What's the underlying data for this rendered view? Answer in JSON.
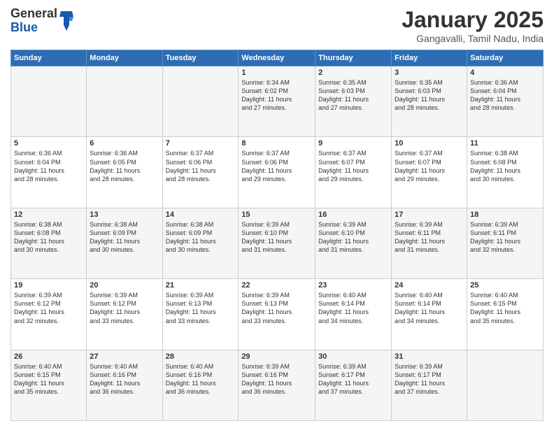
{
  "header": {
    "logo_general": "General",
    "logo_blue": "Blue",
    "title": "January 2025",
    "location": "Gangavalli, Tamil Nadu, India"
  },
  "days_of_week": [
    "Sunday",
    "Monday",
    "Tuesday",
    "Wednesday",
    "Thursday",
    "Friday",
    "Saturday"
  ],
  "weeks": [
    [
      {
        "day": "",
        "info": ""
      },
      {
        "day": "",
        "info": ""
      },
      {
        "day": "",
        "info": ""
      },
      {
        "day": "1",
        "info": "Sunrise: 6:34 AM\nSunset: 6:02 PM\nDaylight: 11 hours\nand 27 minutes."
      },
      {
        "day": "2",
        "info": "Sunrise: 6:35 AM\nSunset: 6:03 PM\nDaylight: 11 hours\nand 27 minutes."
      },
      {
        "day": "3",
        "info": "Sunrise: 6:35 AM\nSunset: 6:03 PM\nDaylight: 11 hours\nand 28 minutes."
      },
      {
        "day": "4",
        "info": "Sunrise: 6:36 AM\nSunset: 6:04 PM\nDaylight: 11 hours\nand 28 minutes."
      }
    ],
    [
      {
        "day": "5",
        "info": "Sunrise: 6:36 AM\nSunset: 6:04 PM\nDaylight: 11 hours\nand 28 minutes."
      },
      {
        "day": "6",
        "info": "Sunrise: 6:36 AM\nSunset: 6:05 PM\nDaylight: 11 hours\nand 28 minutes."
      },
      {
        "day": "7",
        "info": "Sunrise: 6:37 AM\nSunset: 6:06 PM\nDaylight: 11 hours\nand 28 minutes."
      },
      {
        "day": "8",
        "info": "Sunrise: 6:37 AM\nSunset: 6:06 PM\nDaylight: 11 hours\nand 29 minutes."
      },
      {
        "day": "9",
        "info": "Sunrise: 6:37 AM\nSunset: 6:07 PM\nDaylight: 11 hours\nand 29 minutes."
      },
      {
        "day": "10",
        "info": "Sunrise: 6:37 AM\nSunset: 6:07 PM\nDaylight: 11 hours\nand 29 minutes."
      },
      {
        "day": "11",
        "info": "Sunrise: 6:38 AM\nSunset: 6:08 PM\nDaylight: 11 hours\nand 30 minutes."
      }
    ],
    [
      {
        "day": "12",
        "info": "Sunrise: 6:38 AM\nSunset: 6:08 PM\nDaylight: 11 hours\nand 30 minutes."
      },
      {
        "day": "13",
        "info": "Sunrise: 6:38 AM\nSunset: 6:09 PM\nDaylight: 11 hours\nand 30 minutes."
      },
      {
        "day": "14",
        "info": "Sunrise: 6:38 AM\nSunset: 6:09 PM\nDaylight: 11 hours\nand 30 minutes."
      },
      {
        "day": "15",
        "info": "Sunrise: 6:39 AM\nSunset: 6:10 PM\nDaylight: 11 hours\nand 31 minutes."
      },
      {
        "day": "16",
        "info": "Sunrise: 6:39 AM\nSunset: 6:10 PM\nDaylight: 11 hours\nand 31 minutes."
      },
      {
        "day": "17",
        "info": "Sunrise: 6:39 AM\nSunset: 6:11 PM\nDaylight: 11 hours\nand 31 minutes."
      },
      {
        "day": "18",
        "info": "Sunrise: 6:39 AM\nSunset: 6:11 PM\nDaylight: 11 hours\nand 32 minutes."
      }
    ],
    [
      {
        "day": "19",
        "info": "Sunrise: 6:39 AM\nSunset: 6:12 PM\nDaylight: 11 hours\nand 32 minutes."
      },
      {
        "day": "20",
        "info": "Sunrise: 6:39 AM\nSunset: 6:12 PM\nDaylight: 11 hours\nand 33 minutes."
      },
      {
        "day": "21",
        "info": "Sunrise: 6:39 AM\nSunset: 6:13 PM\nDaylight: 11 hours\nand 33 minutes."
      },
      {
        "day": "22",
        "info": "Sunrise: 6:39 AM\nSunset: 6:13 PM\nDaylight: 11 hours\nand 33 minutes."
      },
      {
        "day": "23",
        "info": "Sunrise: 6:40 AM\nSunset: 6:14 PM\nDaylight: 11 hours\nand 34 minutes."
      },
      {
        "day": "24",
        "info": "Sunrise: 6:40 AM\nSunset: 6:14 PM\nDaylight: 11 hours\nand 34 minutes."
      },
      {
        "day": "25",
        "info": "Sunrise: 6:40 AM\nSunset: 6:15 PM\nDaylight: 11 hours\nand 35 minutes."
      }
    ],
    [
      {
        "day": "26",
        "info": "Sunrise: 6:40 AM\nSunset: 6:15 PM\nDaylight: 11 hours\nand 35 minutes."
      },
      {
        "day": "27",
        "info": "Sunrise: 6:40 AM\nSunset: 6:16 PM\nDaylight: 11 hours\nand 36 minutes."
      },
      {
        "day": "28",
        "info": "Sunrise: 6:40 AM\nSunset: 6:16 PM\nDaylight: 11 hours\nand 36 minutes."
      },
      {
        "day": "29",
        "info": "Sunrise: 6:39 AM\nSunset: 6:16 PM\nDaylight: 11 hours\nand 36 minutes."
      },
      {
        "day": "30",
        "info": "Sunrise: 6:39 AM\nSunset: 6:17 PM\nDaylight: 11 hours\nand 37 minutes."
      },
      {
        "day": "31",
        "info": "Sunrise: 6:39 AM\nSunset: 6:17 PM\nDaylight: 11 hours\nand 37 minutes."
      },
      {
        "day": "",
        "info": ""
      }
    ]
  ]
}
